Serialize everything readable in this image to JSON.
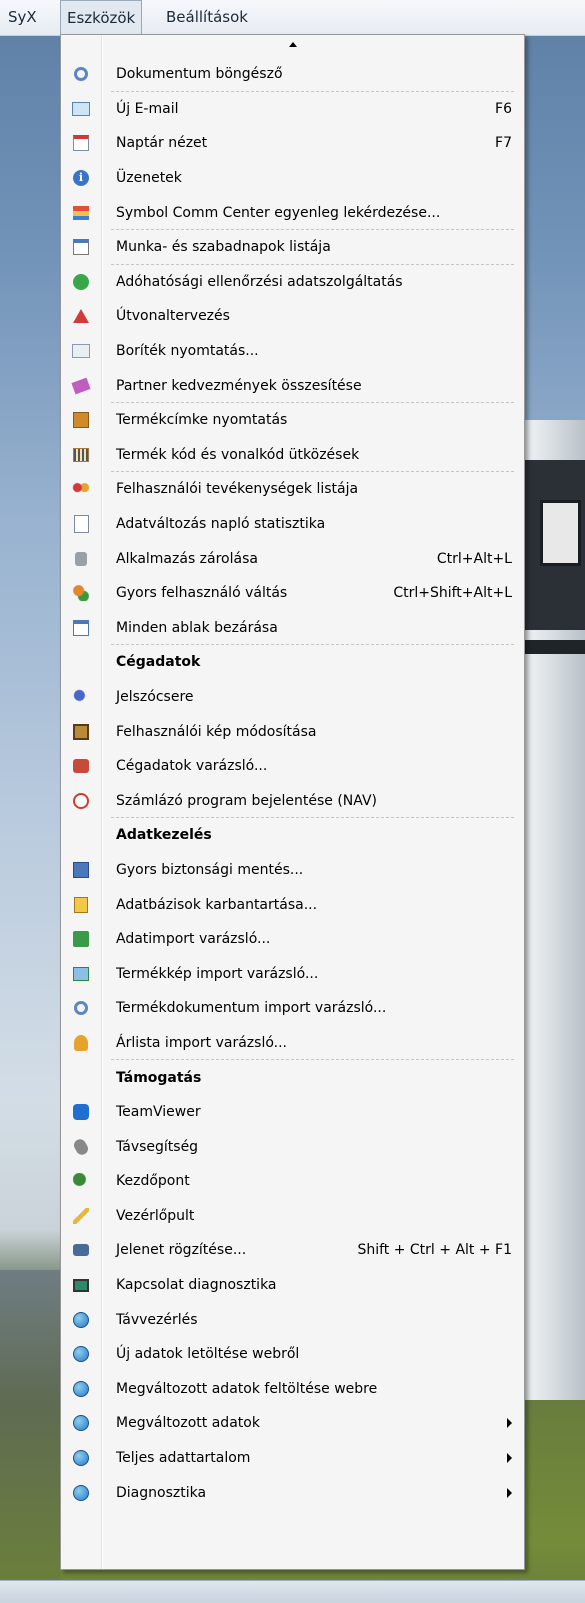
{
  "menubar": {
    "items": [
      {
        "label": "SyX"
      },
      {
        "label": "Eszközök"
      },
      {
        "label": "Beállítások"
      }
    ]
  },
  "dropdown": {
    "items": [
      {
        "label": "Dokumentum böngésző",
        "shortcut": "",
        "icon": "paperclip-icon",
        "separator_after": true
      },
      {
        "label": "Új E-mail",
        "shortcut": "F6",
        "icon": "email-icon"
      },
      {
        "label": "Naptár nézet",
        "shortcut": "F7",
        "icon": "calendar-icon"
      },
      {
        "label": "Üzenetek",
        "shortcut": "",
        "icon": "info-icon"
      },
      {
        "label": "Symbol Comm Center egyenleg lekérdezése...",
        "shortcut": "",
        "icon": "symbol-comm-icon",
        "separator_after": true
      },
      {
        "label": "Munka- és szabadnapok listája",
        "shortcut": "",
        "icon": "workdays-calendar-icon",
        "separator_after": true
      },
      {
        "label": "Adóhatósági ellenőrzési adatszolgáltatás",
        "shortcut": "",
        "icon": "green-arrow-icon"
      },
      {
        "label": "Útvonaltervezés",
        "shortcut": "",
        "icon": "warning-triangle-icon"
      },
      {
        "label": "Boríték nyomtatás...",
        "shortcut": "",
        "icon": "envelope-icon"
      },
      {
        "label": "Partner kedvezmények összesítése",
        "shortcut": "",
        "icon": "discount-tag-icon",
        "separator_after": true
      },
      {
        "label": "Termékcímke nyomtatás",
        "shortcut": "",
        "icon": "product-box-icon"
      },
      {
        "label": "Termék kód és vonalkód ütközések",
        "shortcut": "",
        "icon": "barcode-icon",
        "separator_after": true
      },
      {
        "label": "Felhasználói tevékenységek listája",
        "shortcut": "",
        "icon": "users-icon"
      },
      {
        "label": "Adatváltozás napló statisztika",
        "shortcut": "",
        "icon": "document-icon"
      },
      {
        "label": "Alkalmazás zárolása",
        "shortcut": "Ctrl+Alt+L",
        "icon": "lock-icon"
      },
      {
        "label": "Gyors felhasználó váltás",
        "shortcut": "Ctrl+Shift+Alt+L",
        "icon": "user-switch-icon"
      },
      {
        "label": "Minden ablak bezárása",
        "shortcut": "",
        "icon": "close-windows-icon",
        "separator_after": true
      },
      {
        "label": "Cégadatok",
        "header": true
      },
      {
        "label": "Jelszócsere",
        "shortcut": "",
        "icon": "keys-icon"
      },
      {
        "label": "Felhasználói kép módosítása",
        "shortcut": "",
        "icon": "user-photo-icon"
      },
      {
        "label": "Cégadatok varázsló...",
        "shortcut": "",
        "icon": "company-wizard-icon"
      },
      {
        "label": "Számlázó program bejelentése (NAV)",
        "shortcut": "",
        "icon": "nav-icon",
        "separator_after": true
      },
      {
        "label": "Adatkezelés",
        "header": true
      },
      {
        "label": "Gyors biztonsági mentés...",
        "shortcut": "",
        "icon": "backup-icon"
      },
      {
        "label": "Adatbázisok karbantartása...",
        "shortcut": "",
        "icon": "database-maintenance-icon"
      },
      {
        "label": "Adatimport varázsló...",
        "shortcut": "",
        "icon": "data-import-icon"
      },
      {
        "label": "Termékkép import varázsló...",
        "shortcut": "",
        "icon": "image-import-icon"
      },
      {
        "label": "Termékdokumentum import varázsló...",
        "shortcut": "",
        "icon": "paperclip-icon"
      },
      {
        "label": "Árlista import varázsló...",
        "shortcut": "",
        "icon": "price-list-icon",
        "separator_after": true
      },
      {
        "label": "Támogatás",
        "header": true
      },
      {
        "label": "TeamViewer",
        "shortcut": "",
        "icon": "teamviewer-icon"
      },
      {
        "label": "Távsegítség",
        "shortcut": "",
        "icon": "mouse-icon"
      },
      {
        "label": "Kezdőpont",
        "shortcut": "",
        "icon": "start-point-icon"
      },
      {
        "label": "Vezérlőpult",
        "shortcut": "",
        "icon": "control-panel-icon"
      },
      {
        "label": "Jelenet rögzítése...",
        "shortcut": "Shift + Ctrl + Alt + F1",
        "icon": "camera-icon"
      },
      {
        "label": "Kapcsolat diagnosztika",
        "shortcut": "",
        "icon": "monitor-icon"
      },
      {
        "label": "Távvezérlés",
        "shortcut": "",
        "icon": "globe-icon"
      },
      {
        "label": "Új adatok letöltése webről",
        "shortcut": "",
        "icon": "globe-icon"
      },
      {
        "label": "Megváltozott adatok feltöltése webre",
        "shortcut": "",
        "icon": "globe-icon"
      },
      {
        "label": "Megváltozott adatok",
        "shortcut": "",
        "icon": "globe-icon",
        "submenu": true
      },
      {
        "label": "Teljes adattartalom",
        "shortcut": "",
        "icon": "globe-icon",
        "submenu": true
      },
      {
        "label": "Diagnosztika",
        "shortcut": "",
        "icon": "globe-icon",
        "submenu": true
      }
    ]
  }
}
